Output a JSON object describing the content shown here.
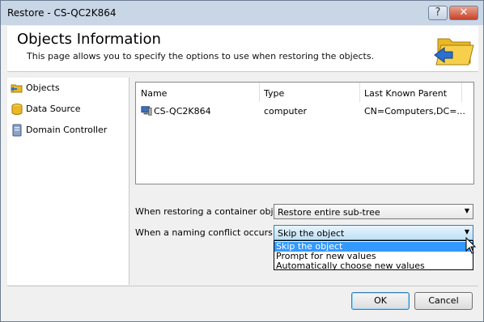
{
  "window": {
    "title": "Restore - CS-QC2K864",
    "help_glyph": "?",
    "close_glyph": "✕"
  },
  "header": {
    "title": "Objects Information",
    "description": "This page allows you to specify the options to use when restoring the objects.",
    "icon": "folder-restore-icon"
  },
  "sidebar": {
    "items": [
      {
        "label": "Objects",
        "icon": "folder-icon"
      },
      {
        "label": "Data Source",
        "icon": "database-icon"
      },
      {
        "label": "Domain Controller",
        "icon": "server-icon"
      }
    ]
  },
  "objects_list": {
    "columns": [
      "Name",
      "Type",
      "Last Known Parent"
    ],
    "rows": [
      {
        "name": "CS-QC2K864",
        "type": "computer",
        "parent": "CN=Computers,DC=...",
        "icon": "computer-icon"
      }
    ]
  },
  "options": {
    "container_label": "When restoring a container object:",
    "container_value": "Restore entire sub-tree",
    "conflict_label": "When a naming conflict occurs:",
    "conflict_value": "Skip the object",
    "conflict_options": [
      "Skip the object",
      "Prompt for new values",
      "Automatically choose new values"
    ]
  },
  "footer": {
    "ok_label": "OK",
    "cancel_label": "Cancel"
  },
  "colors": {
    "selection": "#3399ff",
    "title_bar": "#c9d6e6",
    "close_button": "#c8412a"
  }
}
